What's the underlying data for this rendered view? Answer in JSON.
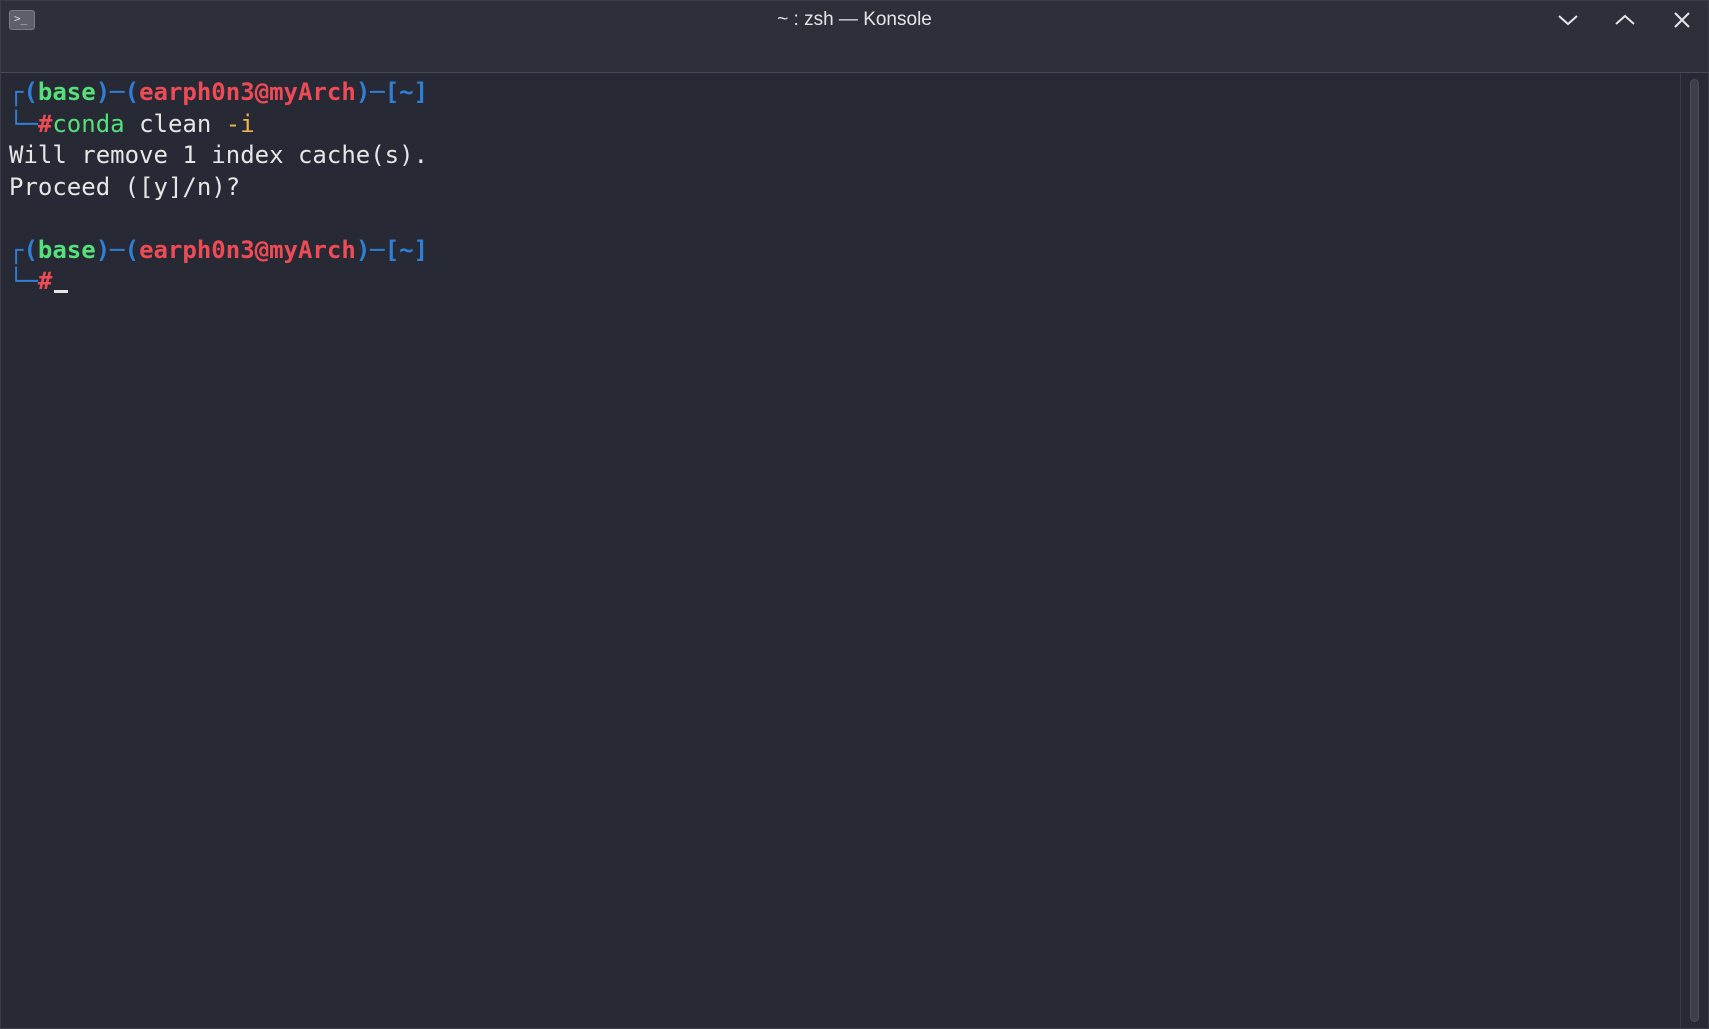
{
  "window": {
    "title": "~ : zsh — Konsole",
    "app_icon": "terminal-icon",
    "app_icon_glyph": ">_",
    "controls": [
      {
        "name": "minimize",
        "icon": "chevron-down-icon"
      },
      {
        "name": "maximize",
        "icon": "chevron-up-icon"
      },
      {
        "name": "close",
        "icon": "close-icon"
      }
    ]
  },
  "colors": {
    "background": "#272a34",
    "prompt_frame": "#2f7fd6",
    "env": "#55e07a",
    "user_host": "#ef4b57",
    "command": "#55e07a",
    "argument_flag": "#f0b54a",
    "output": "#e6e6e6"
  },
  "terminal": {
    "prompt1": {
      "frame_top": "┌",
      "open1": "(",
      "env": "base",
      "close1": ")",
      "dash1": "─",
      "open2": "(",
      "user_host": "earph0n3@myArch",
      "close2": ")",
      "dash2": "─",
      "open3": "[",
      "cwd": "~",
      "close3": "]",
      "frame_bottom": "└─",
      "hash": "#",
      "command": "conda",
      "arg1": "clean",
      "arg2": "-i"
    },
    "output": [
      "Will remove 1 index cache(s).",
      "Proceed ([y]/n)?"
    ],
    "prompt2": {
      "frame_top": "┌",
      "open1": "(",
      "env": "base",
      "close1": ")",
      "dash1": "─",
      "open2": "(",
      "user_host": "earph0n3@myArch",
      "close2": ")",
      "dash2": "─",
      "open3": "[",
      "cwd": "~",
      "close3": "]",
      "frame_bottom": "└─",
      "hash": "#"
    }
  }
}
